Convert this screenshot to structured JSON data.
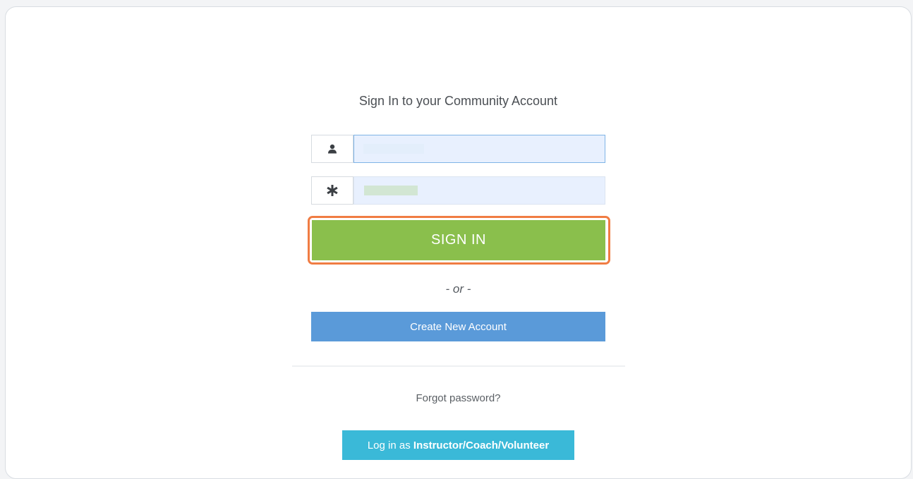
{
  "page": {
    "title": "Sign In to your Community Account"
  },
  "form": {
    "username": {
      "icon": "user-icon",
      "value": ""
    },
    "password": {
      "icon": "asterisk-icon",
      "value": ""
    },
    "sign_in_label": "SIGN IN",
    "or_text": "- or -",
    "create_account_label": "Create New Account",
    "forgot_password_label": "Forgot password?",
    "instructor_prefix": "Log in as",
    "instructor_role": "Instructor/Coach/Volunteer"
  },
  "colors": {
    "sign_in": "#8abf4c",
    "create_account": "#5a9ad9",
    "instructor": "#3ab9d8",
    "highlight": "#f07c43",
    "autofill": "#e8f0fe"
  }
}
